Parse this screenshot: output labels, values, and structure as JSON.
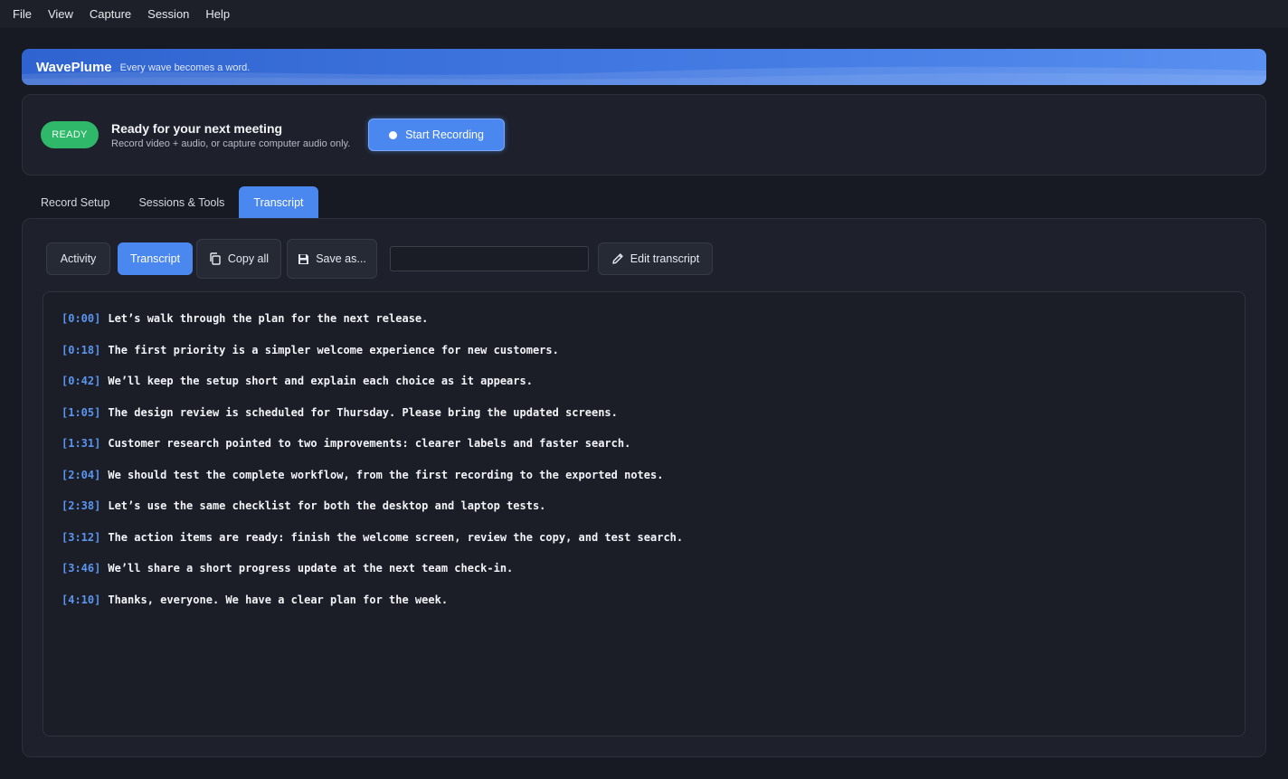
{
  "menu": [
    "File",
    "View",
    "Capture",
    "Session",
    "Help"
  ],
  "banner": {
    "title": "WavePlume",
    "tagline": "Every wave becomes a word."
  },
  "status": {
    "badge": "READY",
    "title": "Ready for your next meeting",
    "subtitle": "Record video + audio, or capture computer audio only.",
    "record_label": "Start Recording"
  },
  "tabs": [
    "Record Setup",
    "Sessions & Tools",
    "Transcript"
  ],
  "active_tab": "Transcript",
  "toolbar": {
    "activity_label": "Activity",
    "transcript_label": "Transcript",
    "copy_label": "Copy all",
    "save_label": "Save as...",
    "search_value": "",
    "edit_label": "Edit transcript"
  },
  "transcript": [
    {
      "time": "[0:00]",
      "text": "Let’s walk through the plan for the next release."
    },
    {
      "time": "[0:18]",
      "text": "The first priority is a simpler welcome experience for new customers."
    },
    {
      "time": "[0:42]",
      "text": "We’ll keep the setup short and explain each choice as it appears."
    },
    {
      "time": "[1:05]",
      "text": "The design review is scheduled for Thursday. Please bring the updated screens."
    },
    {
      "time": "[1:31]",
      "text": "Customer research pointed to two improvements: clearer labels and faster search."
    },
    {
      "time": "[2:04]",
      "text": "We should test the complete workflow, from the first recording to the exported notes."
    },
    {
      "time": "[2:38]",
      "text": "Let’s use the same checklist for both the desktop and laptop tests."
    },
    {
      "time": "[3:12]",
      "text": "The action items are ready: finish the welcome screen, review the copy, and test search."
    },
    {
      "time": "[3:46]",
      "text": "We’ll share a short progress update at the next team check-in."
    },
    {
      "time": "[4:10]",
      "text": "Thanks, everyone. We have a clear plan for the week."
    }
  ],
  "colors": {
    "accent": "#4a88f0",
    "ready": "#2fb86a",
    "timestamp": "#5a95f0",
    "background": "#171a22"
  }
}
